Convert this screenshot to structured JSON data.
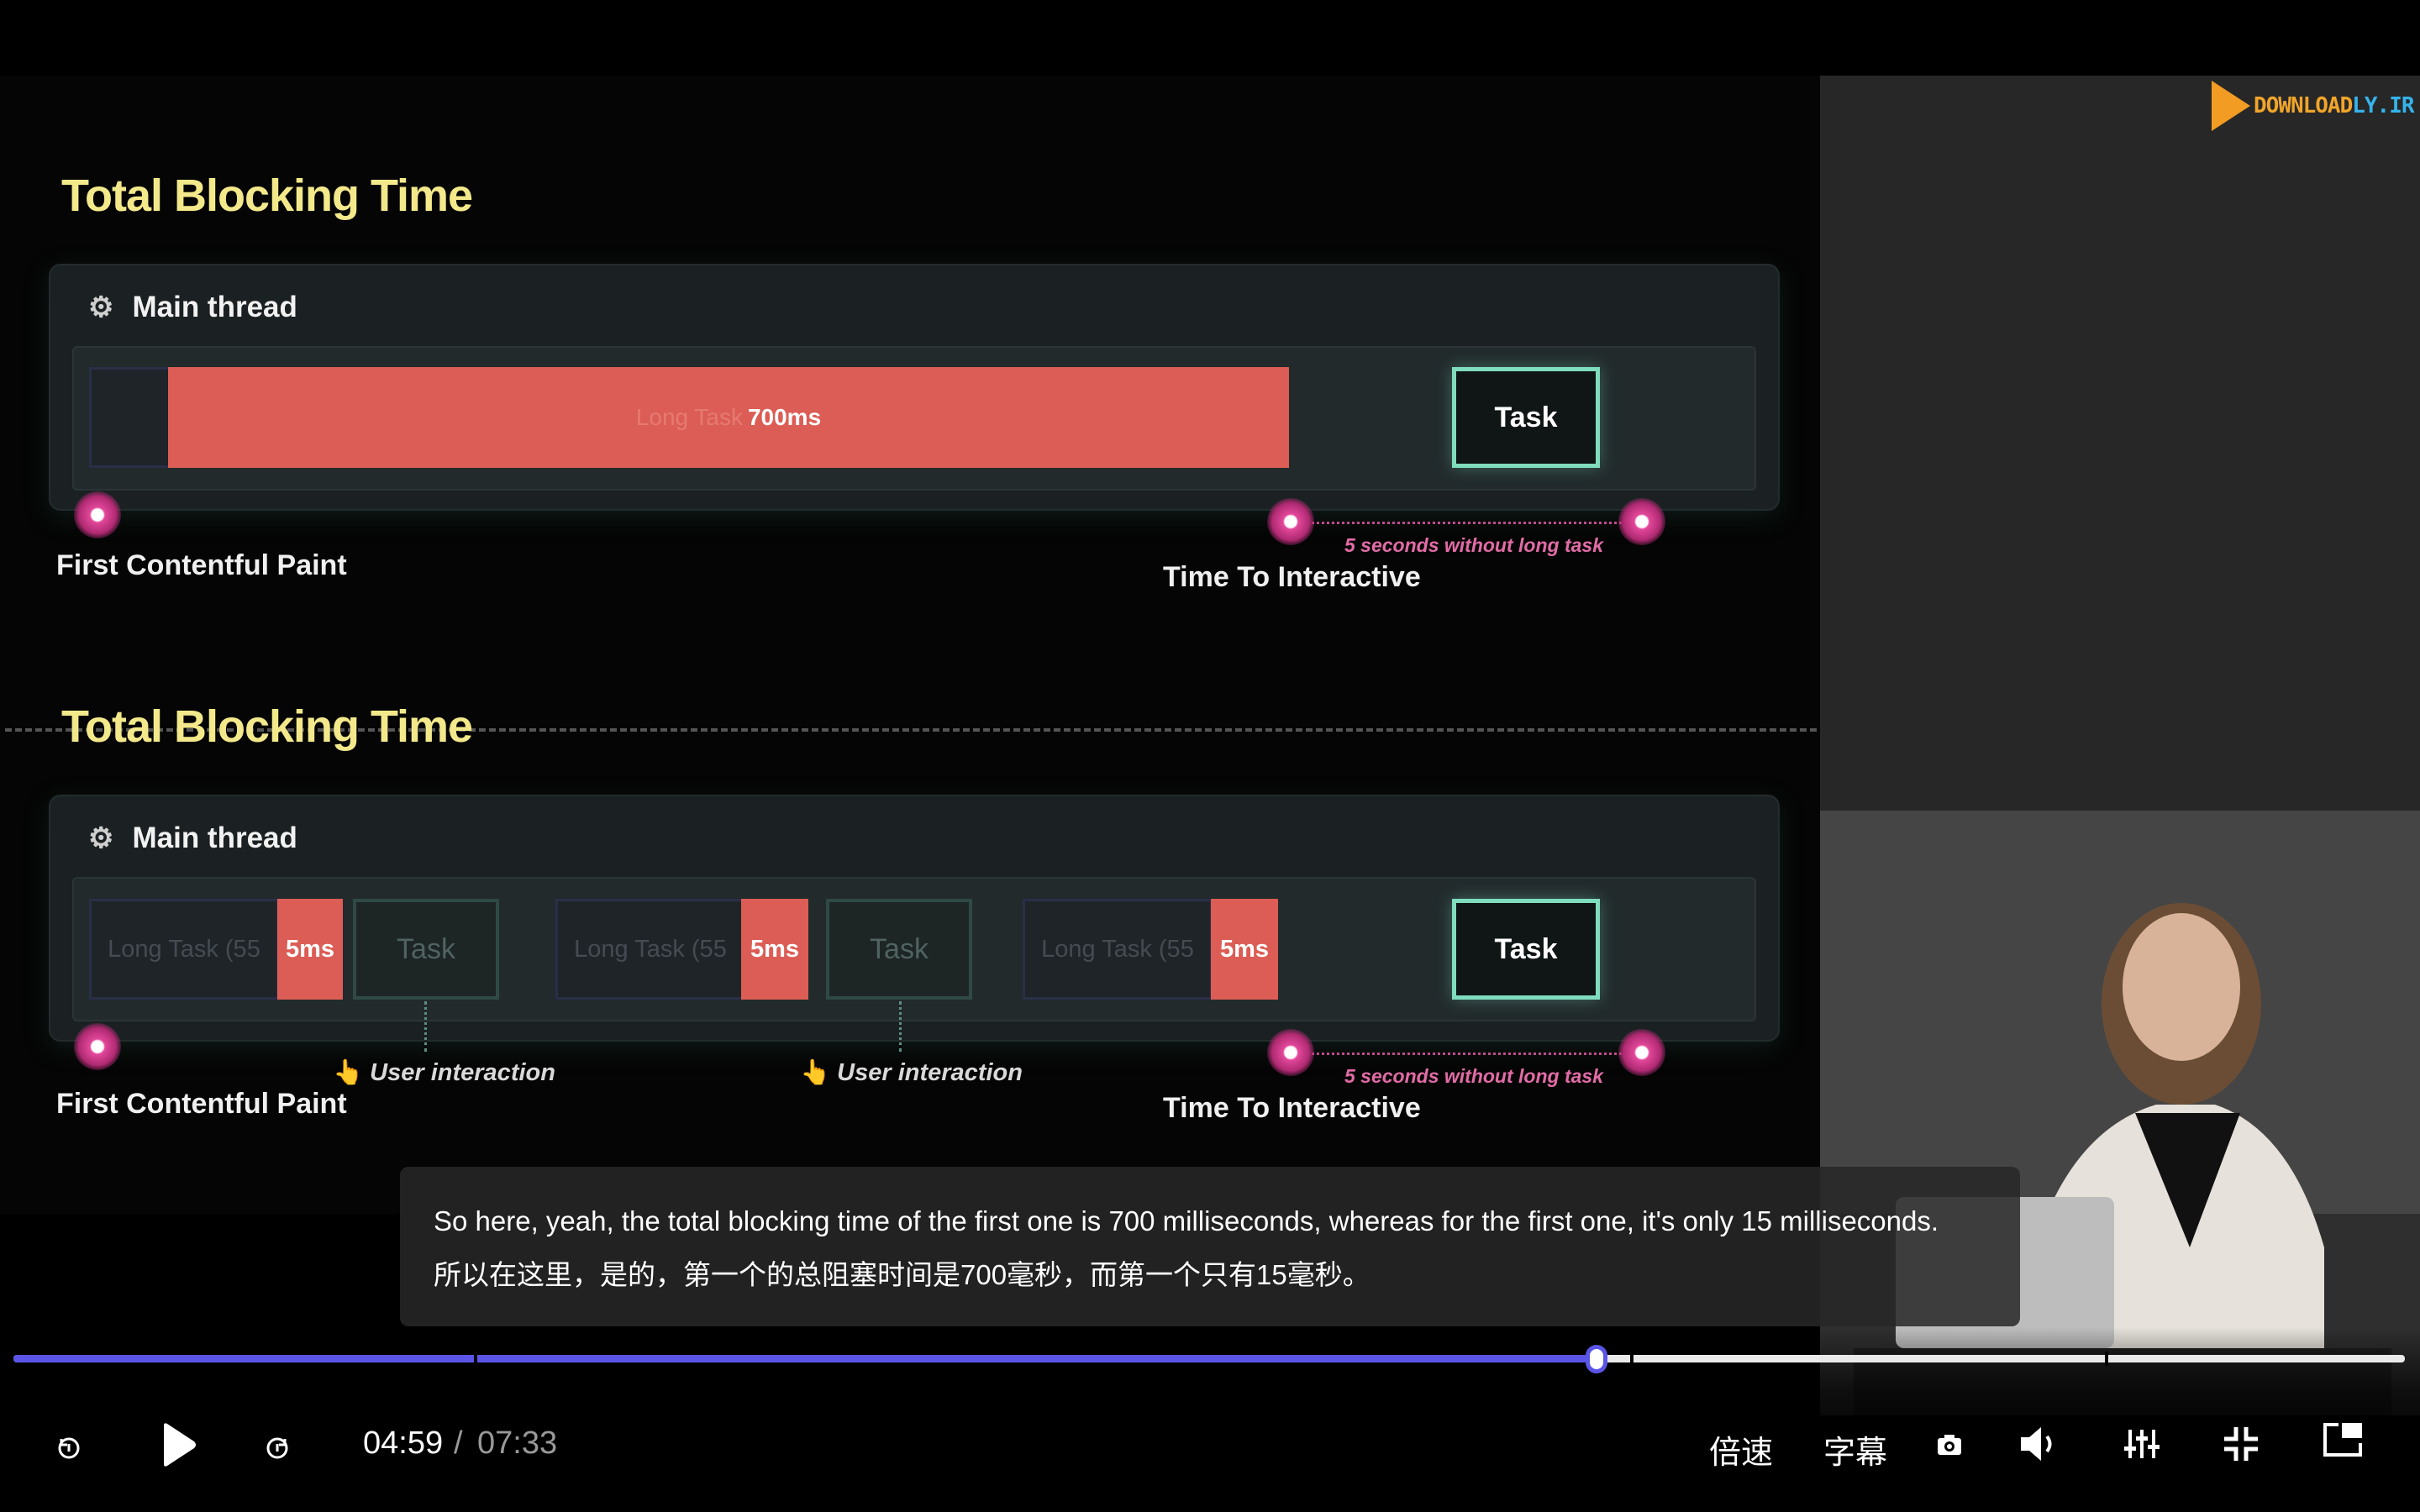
{
  "slide": {
    "top": {
      "title": "Total Blocking Time",
      "thread_label": "Main thread",
      "long_task_ghost": "Long Task",
      "long_task_value": "700ms",
      "task_label": "Task",
      "fcp_label": "First Contentful Paint",
      "tti_label": "Time To Interactive",
      "five_seconds": "5 seconds without long task"
    },
    "bottom": {
      "title": "Total Blocking Time",
      "thread_label": "Main thread",
      "long_task_ghost": "Long Task (55",
      "blocking_value": "5ms",
      "task_label": "Task",
      "user_interaction": "User interaction",
      "fcp_label": "First Contentful Paint",
      "tti_label": "Time To Interactive",
      "five_seconds": "5 seconds without long task"
    }
  },
  "watermark": {
    "text_a": "DOWNLOAD",
    "text_b": "LY.IR"
  },
  "subtitle": {
    "english": "So here, yeah, the total blocking time of the first one is 700 milliseconds, whereas for the first one, it's only 15 milliseconds.",
    "chinese": "所以在这里，是的，第一个的总阻塞时间是700毫秒，而第一个只有15毫秒。"
  },
  "player": {
    "current_time": "04:59",
    "separator": "/",
    "duration": "07:33",
    "progress_fraction": 0.662,
    "speed_label": "倍速",
    "subtitles_label": "字幕",
    "accent_color": "#5a55e6",
    "icons": [
      "rewind-icon",
      "play-icon",
      "forward-icon",
      "screenshot-icon",
      "volume-icon",
      "settings-icon",
      "exit-fullscreen-icon",
      "pip-icon"
    ]
  }
}
